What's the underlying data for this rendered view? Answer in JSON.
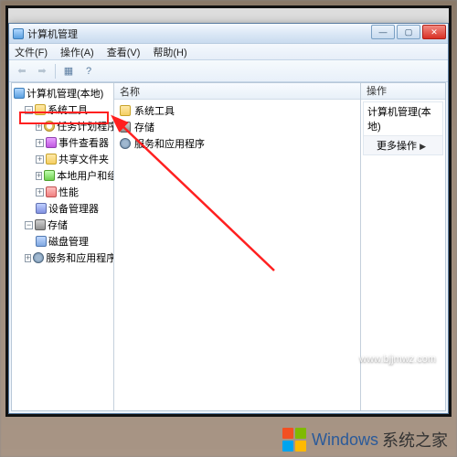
{
  "window": {
    "title": "计算机管理"
  },
  "menubar": {
    "file": "文件(F)",
    "action": "操作(A)",
    "view": "查看(V)",
    "help": "帮助(H)"
  },
  "tree": {
    "root": "计算机管理(本地)",
    "systools": "系统工具",
    "task_scheduler": "任务计划程序",
    "event_viewer": "事件查看器",
    "shared_folders": "共享文件夹",
    "local_users": "本地用户和组",
    "performance": "性能",
    "device_mgr": "设备管理器",
    "storage": "存储",
    "disk_mgmt": "磁盘管理",
    "services_apps": "服务和应用程序"
  },
  "midpane": {
    "header": "名称",
    "items": [
      "系统工具",
      "存储",
      "服务和应用程序"
    ]
  },
  "rightpane": {
    "header": "操作",
    "group_title": "计算机管理(本地)",
    "more_ops": "更多操作"
  },
  "watermark": "www.bjjmwz.com",
  "brand": {
    "main": "Windows",
    "sub": "系统之家"
  }
}
